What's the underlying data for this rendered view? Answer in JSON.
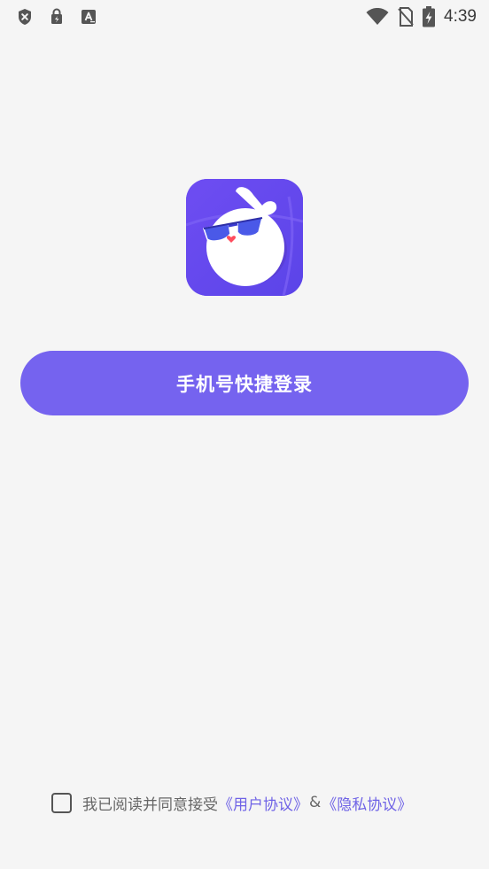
{
  "status_bar": {
    "time": "4:39",
    "left_icons": [
      "shield-x-icon",
      "lock-bag-icon",
      "font-a-icon"
    ],
    "right_icons": [
      "wifi-icon",
      "no-sim-icon",
      "battery-charging-icon"
    ]
  },
  "login": {
    "button_label": "手机号快捷登录"
  },
  "agreement": {
    "prefix": "我已阅读并同意接受",
    "user_agreement": "《用户协议》",
    "separator": "&",
    "privacy_agreement": "《隐私协议》",
    "checked": false
  },
  "colors": {
    "background": "#f5f5f5",
    "accent": "#7563ef",
    "link": "#6f63e6",
    "logo_bg": "#6a4ff0"
  }
}
